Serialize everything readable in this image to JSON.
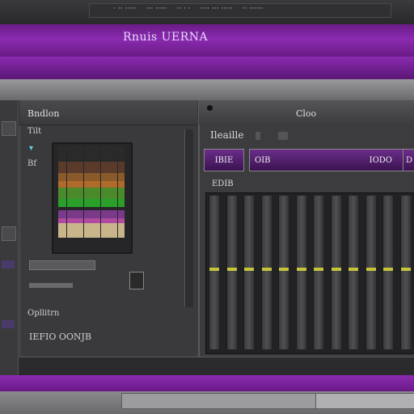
{
  "menu": [
    "· ·· ·····",
    "··· ·····",
    "·· · ·",
    "···· ··· ·····",
    "·· ······"
  ],
  "window_title": "Rnuis UERNA",
  "left_panel": {
    "title": "Bndlon",
    "sub_label": "Tilt",
    "arrow": "▾",
    "rows_label": "Bf",
    "footer_label_1": "Opllitrn",
    "footer_label_2": "IEFIO  OONJB"
  },
  "right_panel": {
    "title": "Cloo",
    "label": "Ileaille",
    "segments": [
      {
        "label": "IBIE"
      },
      {
        "label": "OIB",
        "right": "IODO"
      },
      {
        "label": "D"
      }
    ],
    "eq_label": "EDIB",
    "eq_levels": [
      0.52,
      0.52,
      0.52,
      0.52,
      0.52,
      0.52,
      0.52,
      0.52,
      0.52,
      0.52,
      0.52,
      0.52
    ]
  },
  "colors": {
    "accent": "#8a2bb0",
    "knob": "#c6c43a"
  }
}
